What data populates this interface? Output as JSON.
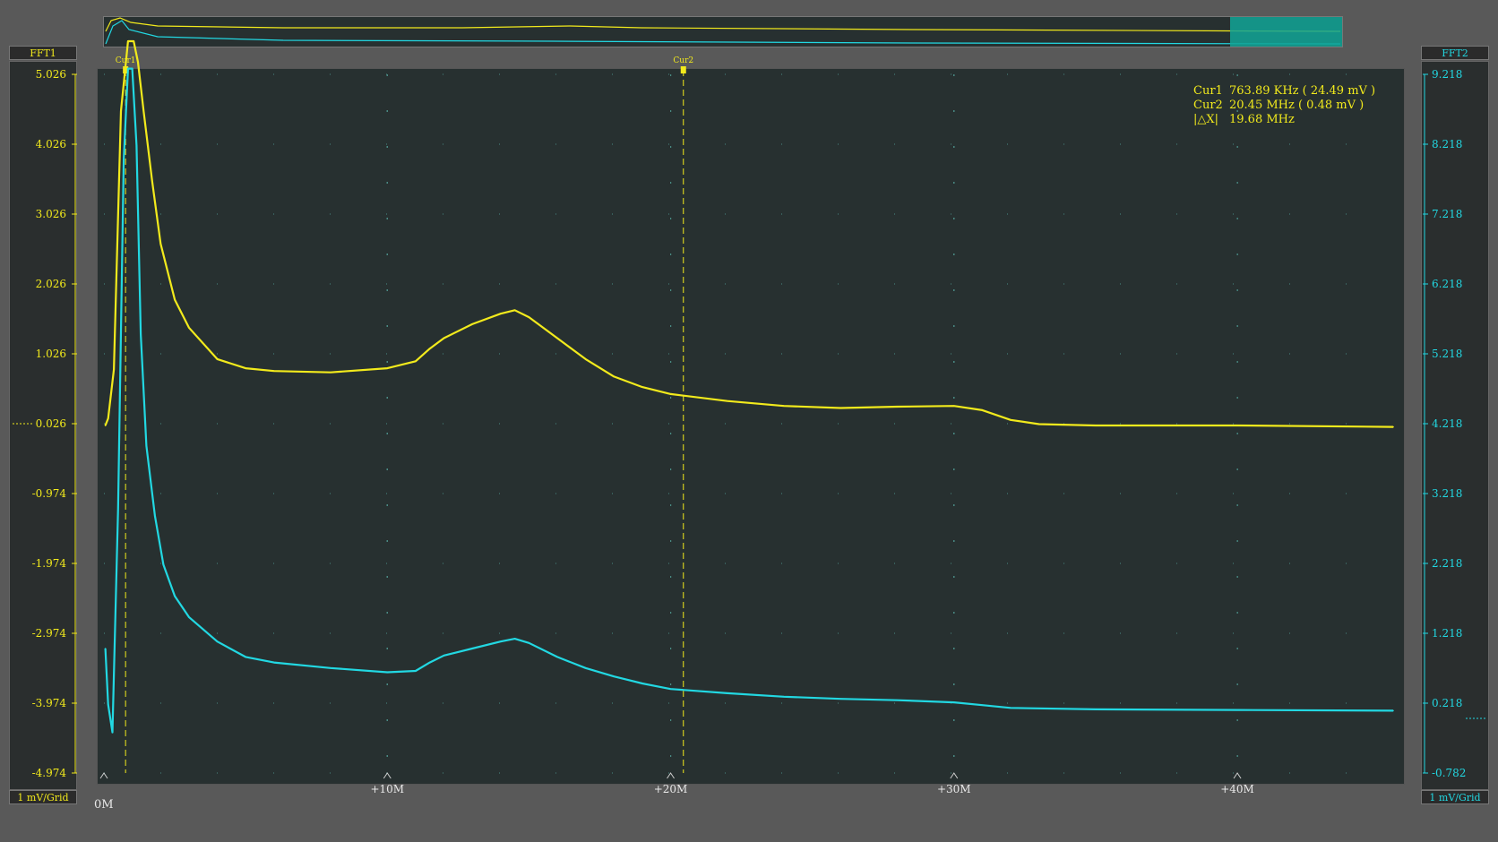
{
  "colors": {
    "ch1": "#f2ea1c",
    "ch2": "#22d8e2",
    "plot_bg": "#273030",
    "frame_bg": "#595959"
  },
  "ch1_panel": {
    "title": "FFT1",
    "scale": "1 mV/Grid",
    "ticks": [
      "5.026",
      "4.026",
      "3.026",
      "2.026",
      "1.026",
      "0.026",
      "-0.974",
      "-1.974",
      "-2.974",
      "-3.974",
      "-4.974"
    ]
  },
  "ch2_panel": {
    "title": "FFT2",
    "scale": "1 mV/Grid",
    "ticks": [
      "9.218",
      "8.218",
      "7.218",
      "6.218",
      "5.218",
      "4.218",
      "3.218",
      "2.218",
      "1.218",
      "0.218",
      "-0.782"
    ]
  },
  "x_axis": {
    "origin_label": "0M",
    "tick_labels": [
      "+10M",
      "+20M",
      "+30M",
      "+40M"
    ]
  },
  "cursors": {
    "cur1": {
      "tag": "Cur1",
      "freq_mhz": 0.76389
    },
    "cur2": {
      "tag": "Cur2",
      "freq_mhz": 20.45
    },
    "readout": [
      {
        "name": "Cur1",
        "value": "763.89 KHz ( 24.49 mV )"
      },
      {
        "name": "Cur2",
        "value": "20.45 MHz ( 0.48 mV )"
      },
      {
        "name": "|△X|",
        "value": "19.68 MHz"
      }
    ]
  },
  "chart_data": {
    "type": "line",
    "xlim": [
      0,
      45.5
    ],
    "series": [
      {
        "axis": "left",
        "ylim": [
          -4.974,
          5.026
        ],
        "x": [
          0.05,
          0.15,
          0.35,
          0.6,
          0.85,
          1.05,
          1.2,
          1.4,
          1.7,
          2.0,
          2.5,
          3,
          4,
          5,
          6,
          8,
          10,
          11,
          11.5,
          12,
          13,
          14,
          14.5,
          15,
          16,
          17,
          18,
          19,
          20,
          22,
          24,
          26,
          28,
          30,
          31,
          32,
          33,
          35,
          40,
          45.5
        ],
        "y": [
          0.0,
          0.1,
          0.8,
          4.5,
          5.5,
          5.5,
          5.2,
          4.5,
          3.5,
          2.6,
          1.8,
          1.4,
          0.95,
          0.82,
          0.78,
          0.76,
          0.82,
          0.92,
          1.1,
          1.25,
          1.45,
          1.6,
          1.65,
          1.55,
          1.25,
          0.95,
          0.7,
          0.55,
          0.45,
          0.35,
          0.28,
          0.25,
          0.27,
          0.28,
          0.22,
          0.08,
          0.02,
          0.0,
          0.0,
          -0.02
        ]
      },
      {
        "axis": "right",
        "ylim": [
          -0.782,
          9.218
        ],
        "x": [
          0.05,
          0.15,
          0.3,
          0.5,
          0.7,
          0.85,
          1.0,
          1.15,
          1.3,
          1.5,
          1.8,
          2.1,
          2.5,
          3,
          4,
          5,
          6,
          8,
          10,
          11,
          11.5,
          12,
          13,
          14,
          14.5,
          15,
          16,
          17,
          18,
          19,
          20,
          22,
          24,
          26,
          28,
          30,
          31,
          32,
          35,
          40,
          45.5
        ],
        "y": [
          1.0,
          0.2,
          -0.2,
          3.0,
          8.0,
          9.3,
          9.3,
          8.2,
          5.5,
          3.9,
          2.9,
          2.2,
          1.75,
          1.45,
          1.1,
          0.88,
          0.8,
          0.72,
          0.66,
          0.68,
          0.8,
          0.9,
          1.0,
          1.1,
          1.14,
          1.08,
          0.88,
          0.72,
          0.6,
          0.5,
          0.42,
          0.36,
          0.31,
          0.28,
          0.26,
          0.23,
          0.19,
          0.15,
          0.13,
          0.12,
          0.11
        ]
      }
    ]
  }
}
